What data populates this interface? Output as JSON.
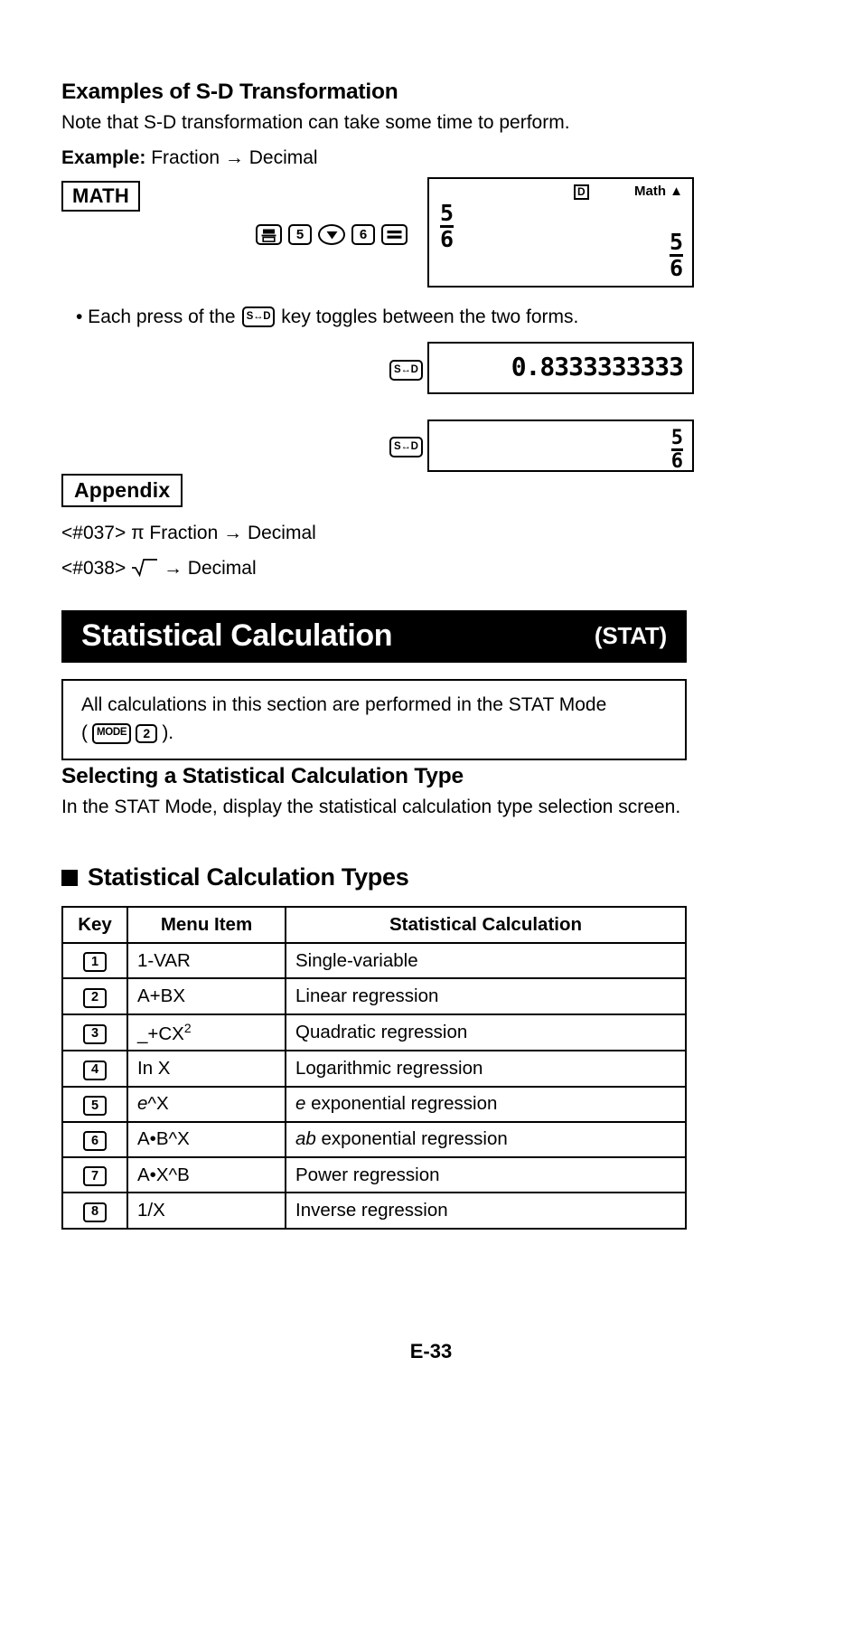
{
  "section_sd": {
    "heading": "Examples of S-D Transformation",
    "note": "Note that S-D transformation can take some time to perform.",
    "example_label": "Example:",
    "example_text": "Fraction → Decimal",
    "math_tag": "MATH",
    "keys": [
      {
        "name": "fraction-key",
        "label": "▬̲▭"
      },
      {
        "name": "digit-5-key",
        "label": "5"
      },
      {
        "name": "down-arrow-key",
        "label": "▼"
      },
      {
        "name": "digit-6-key",
        "label": "6"
      },
      {
        "name": "equals-key",
        "label": "="
      }
    ],
    "display1": {
      "annunciator_d": "D",
      "annunciator_math": "Math ▲",
      "entry_numerator": "5",
      "entry_denominator": "6",
      "result_numerator": "5",
      "result_denominator": "6"
    },
    "toggle_note_pre": "• Each press of the",
    "toggle_key_label": "S↔D",
    "toggle_note_post": "key toggles between the two forms.",
    "display2": {
      "value": "0.8333333333"
    },
    "display3": {
      "numerator": "5",
      "denominator": "6"
    }
  },
  "appendix": {
    "tag": "Appendix",
    "entries": [
      {
        "ref": "<#037>",
        "text": "π Fraction → Decimal"
      },
      {
        "ref": "<#038>",
        "text": "→ Decimal",
        "has_sqrt": true
      }
    ]
  },
  "stat_section": {
    "banner_title": "Statistical Calculation",
    "banner_sub": "(STAT)",
    "note_line1": "All calculations in this section are performed in the STAT Mode",
    "note_mode_key": "MODE",
    "note_digit_key": "2",
    "note_paren_open": "(",
    "note_paren_close": ").",
    "selecting_heading": "Selecting a Statistical Calculation Type",
    "selecting_body": "In the STAT Mode, display the statistical calculation type selection screen.",
    "types_heading": "Statistical Calculation Types",
    "table": {
      "headers": [
        "Key",
        "Menu Item",
        "Statistical Calculation"
      ],
      "rows": [
        {
          "key": "1",
          "menu": "1-VAR",
          "calc": "Single-variable"
        },
        {
          "key": "2",
          "menu": "A+BX",
          "calc": "Linear regression"
        },
        {
          "key": "3",
          "menu": "_+CX2",
          "calc": "Quadratic regression"
        },
        {
          "key": "4",
          "menu": "In X",
          "calc": "Logarithmic regression"
        },
        {
          "key": "5",
          "menu": "e^X",
          "calc": "e exponential regression"
        },
        {
          "key": "6",
          "menu": "A•B^X",
          "calc": "ab exponential regression"
        },
        {
          "key": "7",
          "menu": "A•X^B",
          "calc": "Power regression"
        },
        {
          "key": "8",
          "menu": "1/X",
          "calc": "Inverse regression"
        }
      ]
    }
  },
  "footer": {
    "page_number": "E-33"
  }
}
